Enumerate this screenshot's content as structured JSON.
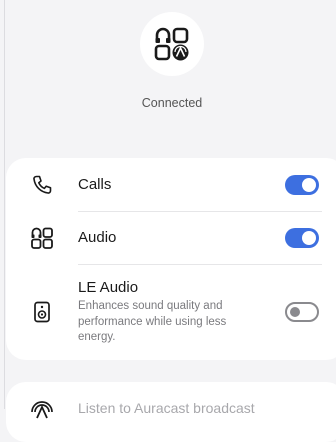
{
  "device": {
    "status": "Connected",
    "icon": "audio-device-icon"
  },
  "settings": [
    {
      "label": "Calls",
      "icon": "phone-icon",
      "enabled": true
    },
    {
      "label": "Audio",
      "icon": "audio-grid-icon",
      "enabled": true
    },
    {
      "label": "LE Audio",
      "icon": "speaker-icon",
      "enabled": false,
      "description_lines": [
        "Enhances sound quality and",
        "performance while using less",
        "energy."
      ]
    }
  ],
  "auracast": {
    "label": "Listen to Auracast broadcast",
    "icon": "auracast-icon"
  },
  "colors": {
    "accent": "#3d6fe0",
    "background": "#f4f4f6",
    "card": "#ffffff"
  }
}
